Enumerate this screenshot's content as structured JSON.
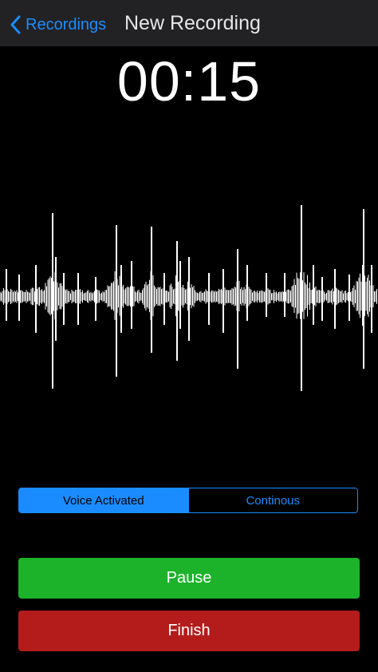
{
  "navbar": {
    "back_label": "Recordings",
    "back_icon": "chevron-left-icon",
    "title": "New Recording"
  },
  "timer": "00:15",
  "mode_control": {
    "options": [
      "Voice Activated",
      "Continous"
    ],
    "selected": "Voice Activated"
  },
  "actions": {
    "pause_label": "Pause",
    "finish_label": "Finish"
  },
  "colors": {
    "accent": "#1a8cff",
    "pause": "#1cb32a",
    "finish": "#b41c1c",
    "navbar": "#222224",
    "background": "#000000"
  }
}
